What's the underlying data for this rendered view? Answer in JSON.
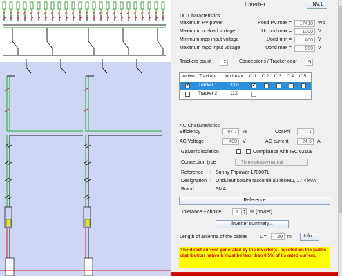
{
  "header": {
    "title": "Inverter",
    "inv_button": "INV.1"
  },
  "dc": {
    "section": "DC Characteristics",
    "rows": [
      {
        "label": "Maximum PV power",
        "right_label": "Pond PV max =",
        "value": "17410",
        "unit": "Wp"
      },
      {
        "label": "Maximum no-load voltage",
        "right_label": "Uo ond max =",
        "value": "1000",
        "unit": "V"
      },
      {
        "label": "Minimum mpp input voltage",
        "right_label": "Uond min =",
        "value": "400",
        "unit": "V"
      },
      {
        "label": "Maximum mpp input voltage",
        "right_label": "Uond max =",
        "value": "800",
        "unit": "V"
      }
    ],
    "trackers_count_label": "Trackers count",
    "trackers_count": "2",
    "connections_label": "Connections / Tracker cour",
    "connections": "5"
  },
  "tracker_table": {
    "headers": [
      "Active",
      "Trackers",
      "Iond max",
      "C 1",
      "C 2",
      "C 3",
      "C 4",
      "C 5"
    ],
    "rows": [
      {
        "active": true,
        "name": "Tracker 1",
        "iond": "33.0",
        "c1": true
      },
      {
        "active": false,
        "name": "Tracker 2",
        "iond": "11.0",
        "c1": false
      }
    ]
  },
  "ac": {
    "section": "AC Characteristics",
    "efficiency_label": "Efficiency",
    "efficiency": "97.7",
    "efficiency_unit": "%",
    "cosphi_label": "CosPhi",
    "cosphi": "1",
    "voltage_label": "AC Voltage",
    "voltage": "400",
    "voltage_unit": "V",
    "current_label": "AC current",
    "current": "24.6",
    "current_unit": "A",
    "galvanic_label": "Galvanic isolation",
    "compliance_label": "Compliance with IEC 62109",
    "connection_label": "Connection type",
    "connection_value": "Three-phase+neutral"
  },
  "info": {
    "reference_label": "Reference",
    "reference": "Sunny Tripower 17000TL",
    "designation_label": "Designation",
    "designation": "Onduleur solaire raccordé au réseau, 17,4 kVA",
    "brand_label": "Brand",
    "brand": "SMA",
    "sep": ":"
  },
  "controls": {
    "reference_button": "Reference",
    "tolerance_label": "Tolerance ± choice",
    "tolerance_value": "1",
    "tolerance_unit": "% (power)",
    "summary_button": "Inverter summary...",
    "cable_label": "Length of antenna of the cables",
    "cable_eq": "L =",
    "cable_value": "20",
    "cable_unit": "m",
    "info_button": "Info..."
  },
  "warning": "The direct current generated by the inverter(s) injected on the public distribution network must be less than 0.5% of its rated current.",
  "colors": {
    "accent": "#2e8ee0",
    "dc_green": "#22aa22",
    "red": "#cc2222",
    "warning_bg": "#ffff00",
    "warning_text": "#cc0000"
  }
}
